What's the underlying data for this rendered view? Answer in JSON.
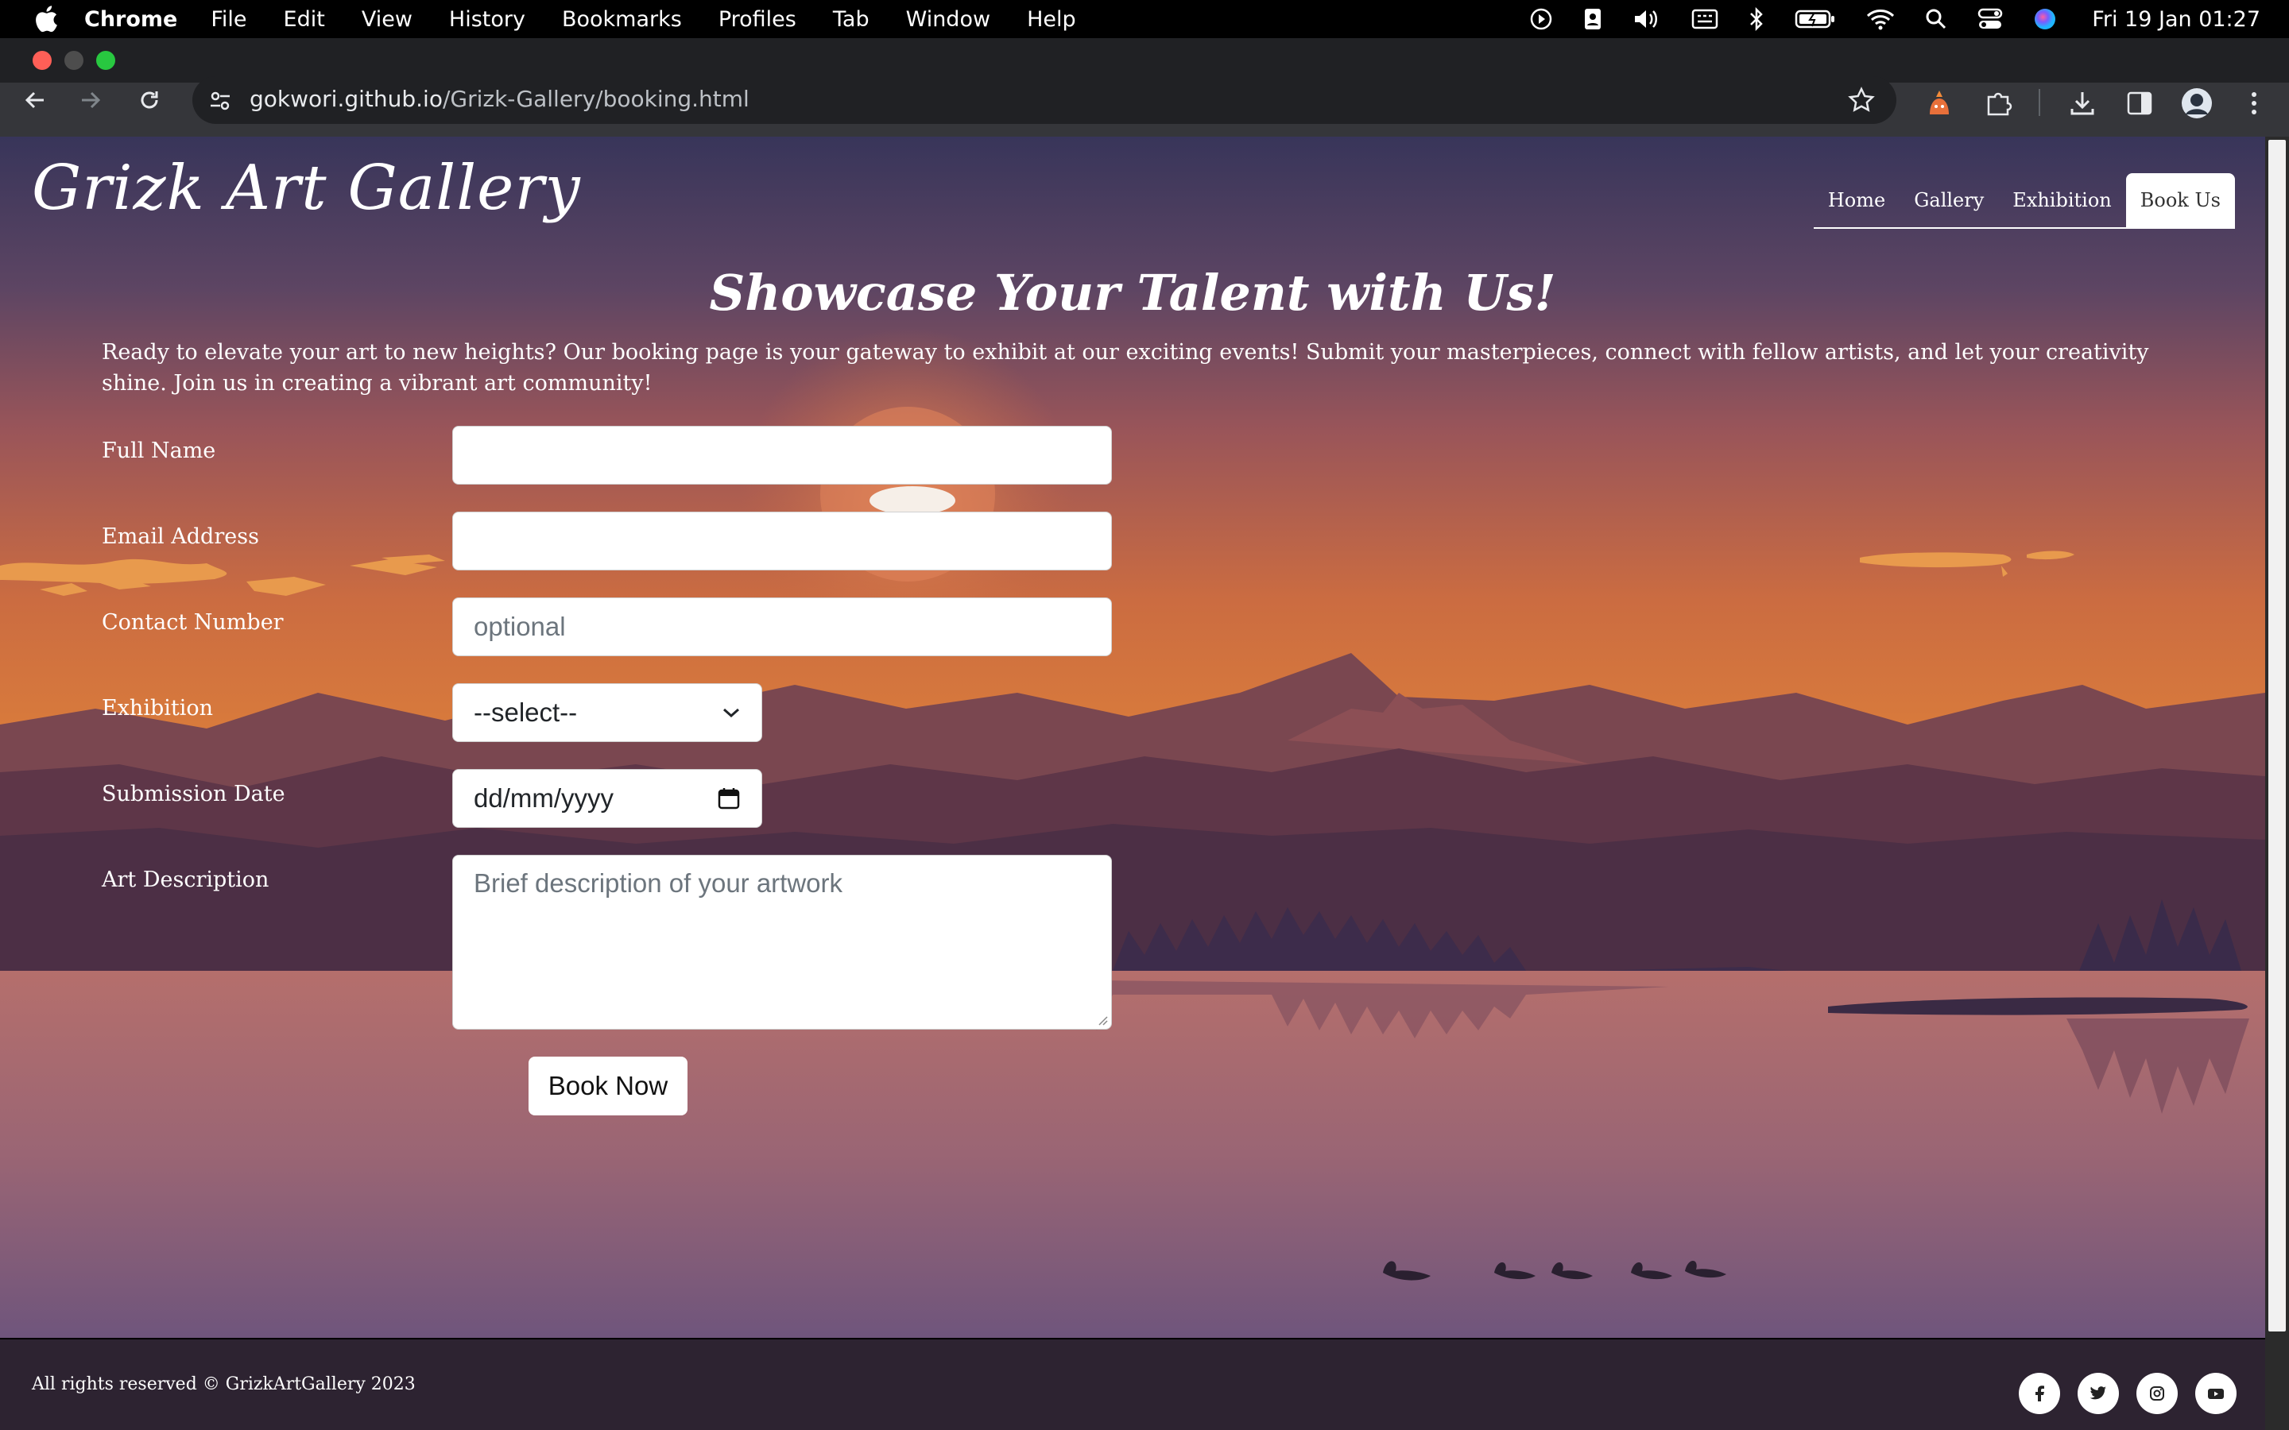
{
  "menubar": {
    "app": "Chrome",
    "items": [
      "File",
      "Edit",
      "View",
      "History",
      "Bookmarks",
      "Profiles",
      "Tab",
      "Window",
      "Help"
    ],
    "clock": "Fri 19 Jan  01:27"
  },
  "browser": {
    "url_host": "gokwori.github.io",
    "url_path": "/Grizk-Gallery/booking.html"
  },
  "site": {
    "logo": "Grizk Art Gallery",
    "nav": {
      "home": "Home",
      "gallery": "Gallery",
      "exhibition": "Exhibition",
      "book": "Book Us"
    },
    "heading": "Showcase Your Talent with Us!",
    "intro": "Ready to elevate your art to new heights? Our booking page is your gateway to exhibit at our exciting events! Submit your masterpieces, connect with fellow artists, and let your creativity shine. Join us in creating a vibrant art community!"
  },
  "form": {
    "full_name": {
      "label": "Full Name",
      "value": "",
      "placeholder": ""
    },
    "email": {
      "label": "Email Address",
      "value": "",
      "placeholder": ""
    },
    "contact": {
      "label": "Contact Number",
      "value": "",
      "placeholder": "optional"
    },
    "exhibition": {
      "label": "Exhibition",
      "selected": "--select--"
    },
    "date": {
      "label": "Submission Date",
      "value": "dd/mm/yyyy"
    },
    "description": {
      "label": "Art Description",
      "value": "",
      "placeholder": "Brief description of your artwork"
    },
    "submit": "Book Now"
  },
  "footer": {
    "copyright": "All rights reserved © GrizkArtGallery 2023",
    "social_icons": [
      "facebook-icon",
      "twitter-icon",
      "instagram-icon",
      "youtube-icon"
    ]
  },
  "colors": {
    "sky_top": "#3a3658",
    "sky_mid": "#c66a42",
    "mountains": "#6b3d4a",
    "water": "#9e6872",
    "footer": "#2d2331"
  }
}
